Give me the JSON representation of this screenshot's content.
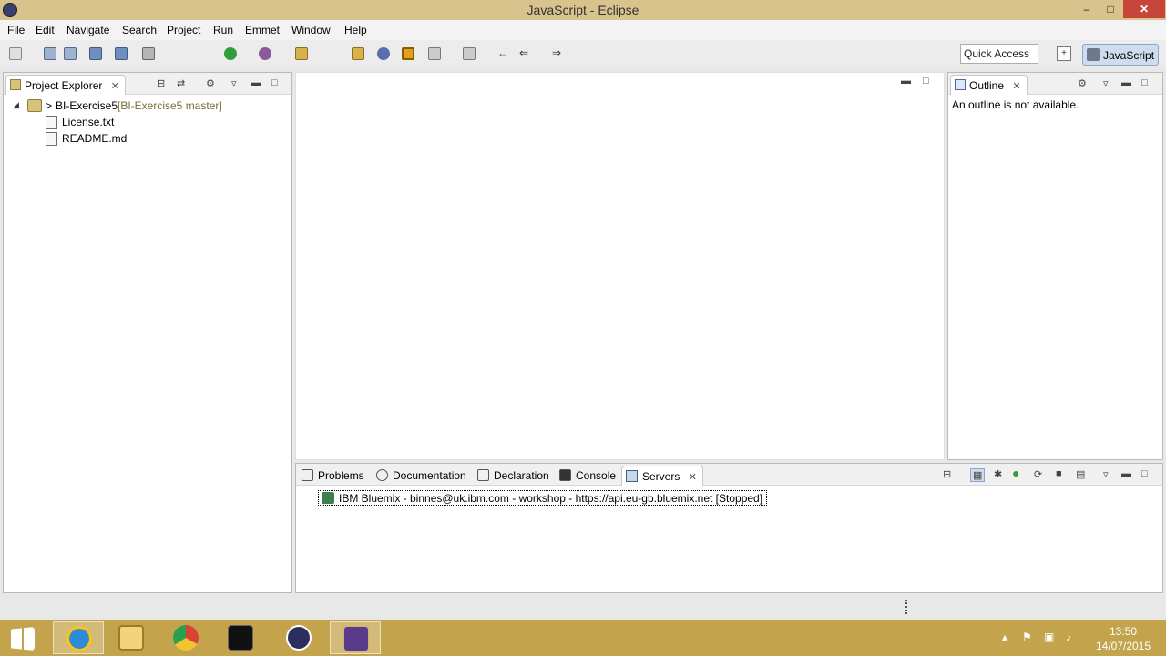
{
  "window": {
    "title": "JavaScript - Eclipse",
    "buttons": {
      "minimize": "–",
      "maximize": "□",
      "close": "✕"
    }
  },
  "menubar": {
    "items": [
      "File",
      "Edit",
      "Navigate",
      "Search",
      "Project",
      "Run",
      "Emmet",
      "Window",
      "Help"
    ]
  },
  "toolbar": {
    "quick_access": "Quick Access",
    "perspective_label": "JavaScript",
    "icons": [
      "new-icon",
      "save-icon",
      "save-all-icon",
      "print-icon",
      "publish-icon",
      "server-icon",
      "run-icon",
      "debug-icon",
      "open-folder-icon",
      "search-icon",
      "bookmark-icon",
      "back-icon",
      "forward-icon"
    ]
  },
  "project_explorer": {
    "title": "Project Explorer",
    "tree": {
      "project_name": "BI-Exercise5",
      "project_prefix": ">",
      "git_decoration": "[BI-Exercise5 master]",
      "files": [
        "License.txt",
        "README.md"
      ]
    }
  },
  "outline": {
    "title": "Outline",
    "message": "An outline is not available."
  },
  "bottom_views": {
    "tabs": [
      "Problems",
      "Documentation",
      "Declaration",
      "Console"
    ],
    "active_tab": "Servers",
    "server_entry": "IBM Bluemix - binnes@uk.ibm.com - workshop - https://api.eu-gb.bluemix.net  [Stopped]"
  },
  "taskbar": {
    "apps": [
      "windows-start-icon",
      "internet-explorer-icon",
      "file-explorer-icon",
      "chrome-icon",
      "command-prompt-icon",
      "eclipse-icon",
      "java-ee-icon"
    ],
    "clock_time": "13:50",
    "clock_date": "14/07/2015"
  },
  "colors": {
    "titlebar": "#d9c38d",
    "taskbar": "#c3a44d",
    "close_button": "#c7463c",
    "perspective_active": "#cfdcee"
  }
}
